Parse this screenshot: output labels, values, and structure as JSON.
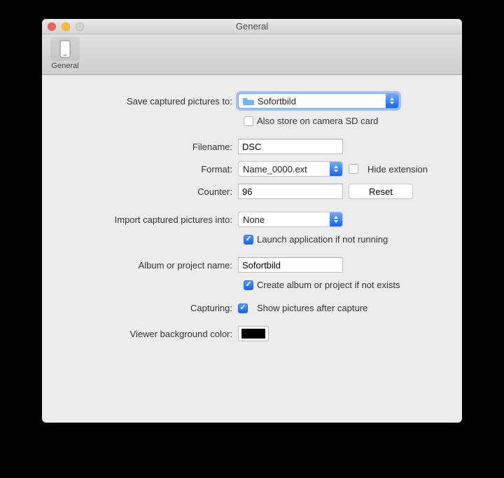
{
  "window": {
    "title": "General"
  },
  "toolbar": {
    "items": [
      {
        "label": "General",
        "selected": true
      }
    ]
  },
  "form": {
    "save_to_label": "Save captured pictures to:",
    "save_to_value": "Sofortbild",
    "sd_card_label": "Also store on camera SD card",
    "sd_card_checked": false,
    "filename_label": "Filename:",
    "filename_value": "DSC",
    "format_label": "Format:",
    "format_value": "Name_0000.ext",
    "hide_ext_label": "Hide extension",
    "hide_ext_checked": false,
    "counter_label": "Counter:",
    "counter_value": "96",
    "reset_label": "Reset",
    "import_into_label": "Import captured pictures into:",
    "import_into_value": "None",
    "launch_app_label": "Launch application if not running",
    "launch_app_checked": true,
    "album_label": "Album or project name:",
    "album_value": "Sofortbild",
    "create_album_label": "Create album or project if not exists",
    "create_album_checked": true,
    "capturing_label": "Capturing:",
    "show_after_label": "Show pictures after capture",
    "show_after_checked": true,
    "viewer_bg_label": "Viewer background color:",
    "viewer_bg_color": "#000000"
  }
}
